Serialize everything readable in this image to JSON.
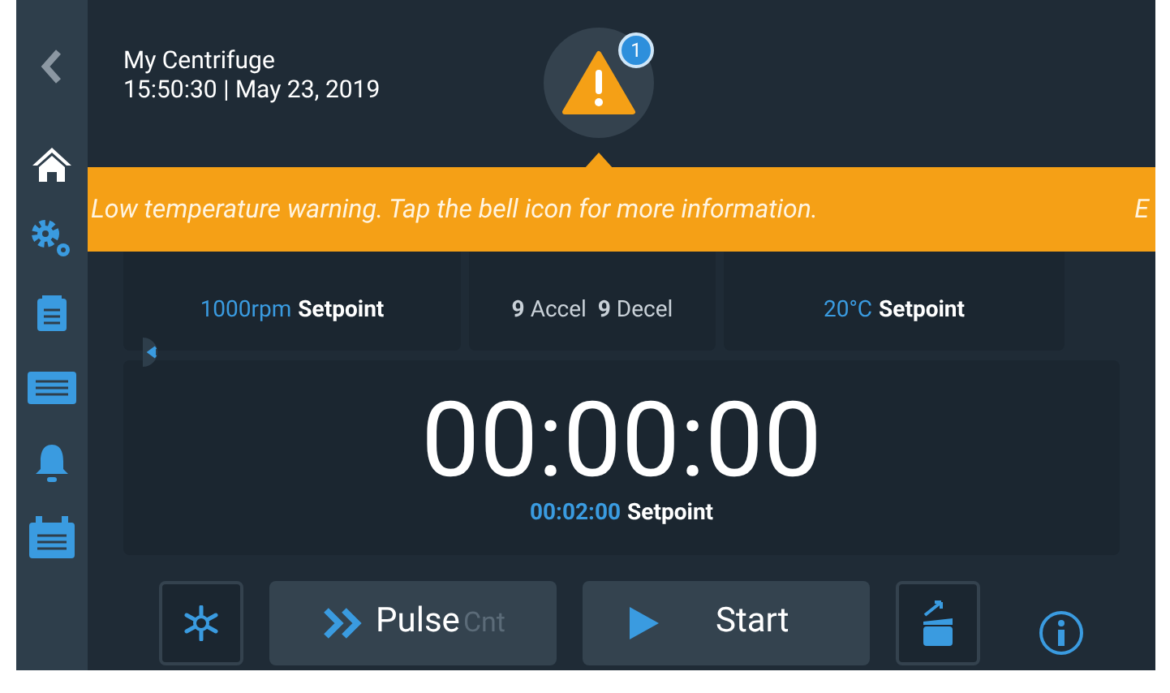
{
  "header": {
    "title": "My Centrifuge",
    "datetime": "15:50:30 | May 23, 2019",
    "alert_count": "1"
  },
  "sidebar": {
    "items": [
      {
        "kind": "back",
        "selected": false
      },
      {
        "kind": "home",
        "selected": true
      },
      {
        "kind": "settings",
        "selected": false
      },
      {
        "kind": "clipboard",
        "selected": false
      },
      {
        "kind": "rack",
        "selected": false
      },
      {
        "kind": "bell",
        "selected": false
      },
      {
        "kind": "calendar",
        "selected": false
      }
    ]
  },
  "banner": {
    "message": "Low temperature warning. Tap the bell icon for more information.",
    "next_message": "E"
  },
  "cards": [
    {
      "kind": "setpoint",
      "value": "1000rpm",
      "label": "Setpoint"
    },
    {
      "kind": "ramp",
      "text": "**9** Accel  **9** Decel"
    },
    {
      "kind": "setpoint",
      "value": "20°C",
      "label": "Setpoint"
    }
  ],
  "timer": {
    "time": "00:00:00",
    "setpoint_value": "00:02:00",
    "setpoint_label": "Setpoint"
  },
  "controls": [
    {
      "kind": "cooling"
    },
    {
      "kind": "pulse",
      "label": "Pulse",
      "sublabel": "Cnt"
    },
    {
      "kind": "start",
      "label": "Start"
    },
    {
      "kind": "lid"
    }
  ]
}
